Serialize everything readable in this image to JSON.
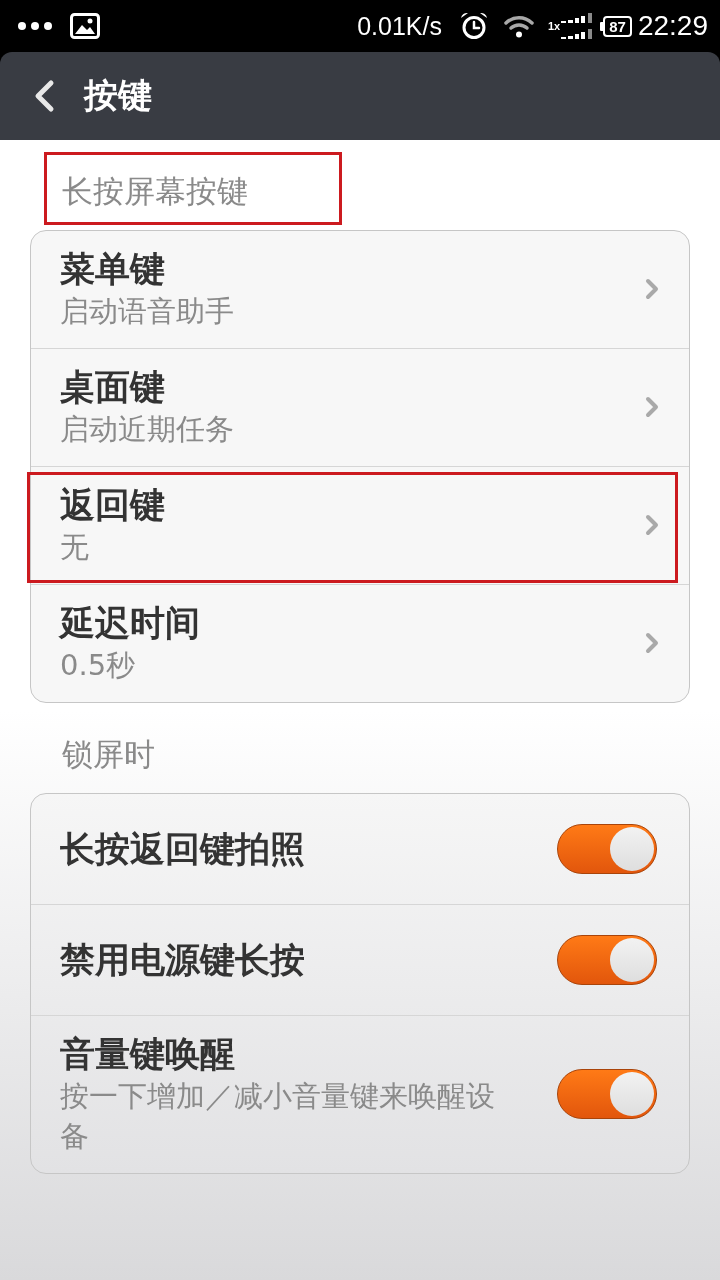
{
  "status_bar": {
    "network_speed": "0.01K/s",
    "network_type": "1x",
    "battery": "87",
    "time": "22:29"
  },
  "header": {
    "title": "按键"
  },
  "sections": [
    {
      "title": "长按屏幕按键",
      "highlighted": true,
      "items": [
        {
          "kind": "link",
          "title": "菜单键",
          "value": "启动语音助手",
          "highlighted": false
        },
        {
          "kind": "link",
          "title": "桌面键",
          "value": "启动近期任务",
          "highlighted": false
        },
        {
          "kind": "link",
          "title": "返回键",
          "value": "无",
          "highlighted": true
        },
        {
          "kind": "link",
          "title": "延迟时间",
          "value": "0.5秒",
          "highlighted": false
        }
      ]
    },
    {
      "title": "锁屏时",
      "highlighted": false,
      "items": [
        {
          "kind": "toggle",
          "title": "长按返回键拍照",
          "on": true,
          "highlighted": false
        },
        {
          "kind": "toggle",
          "title": "禁用电源键长按",
          "on": true,
          "highlighted": false
        },
        {
          "kind": "toggle",
          "title": "音量键唤醒",
          "description": "按一下增加／减小音量键来唤醒设备",
          "on": true,
          "highlighted": false
        }
      ]
    }
  ]
}
